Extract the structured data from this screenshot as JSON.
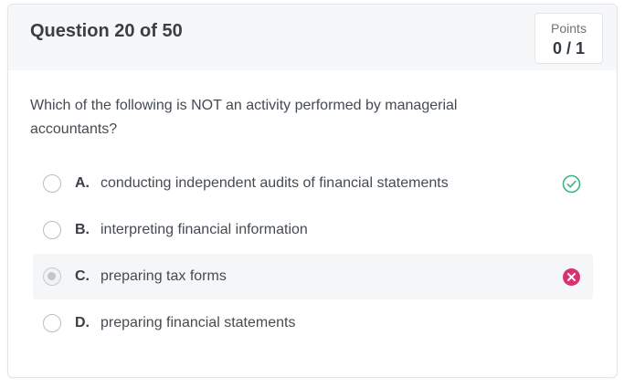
{
  "header": {
    "question_title": "Question 20 of 50",
    "points_label": "Points",
    "points_value": "0 / 1"
  },
  "question": {
    "text": "Which of the following is NOT an activity performed by managerial accountants?"
  },
  "options": [
    {
      "letter": "A.",
      "text": "conducting independent audits of financial statements",
      "status": "correct",
      "icon": "check-circle-icon"
    },
    {
      "letter": "B.",
      "text": "interpreting financial information",
      "status": "none"
    },
    {
      "letter": "C.",
      "text": "preparing tax forms",
      "status": "incorrect-selected",
      "icon": "x-circle-icon"
    },
    {
      "letter": "D.",
      "text": "preparing financial statements",
      "status": "none"
    }
  ],
  "colors": {
    "correct": "#3bb77e",
    "incorrect": "#d6336c"
  }
}
